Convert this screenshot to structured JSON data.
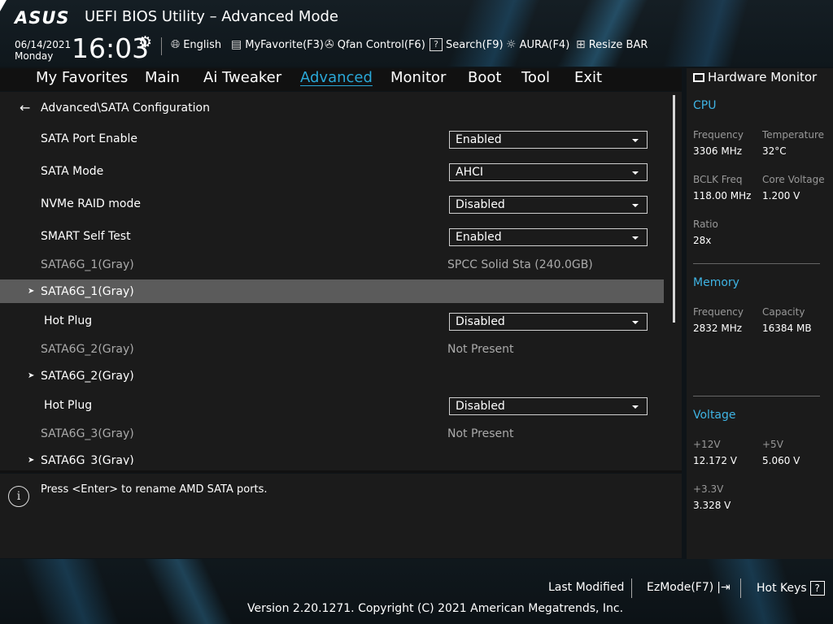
{
  "header": {
    "logo": "ASUS",
    "title": "UEFI BIOS Utility – Advanced Mode",
    "date": "06/14/2021",
    "day": "Monday",
    "time": "16:03"
  },
  "toolbar": [
    {
      "icon": "globe-icon",
      "label": "English"
    },
    {
      "icon": "favorite-list-icon",
      "label": "MyFavorite(F3)"
    },
    {
      "icon": "fan-icon",
      "label": "Qfan Control(F6)"
    },
    {
      "icon": "search-icon",
      "label": "Search(F9)"
    },
    {
      "icon": "aura-icon",
      "label": "AURA(F4)"
    },
    {
      "icon": "resize-bar-icon",
      "label": "Resize BAR"
    }
  ],
  "tabs": [
    "My Favorites",
    "Main",
    "Ai Tweaker",
    "Advanced",
    "Monitor",
    "Boot",
    "Tool",
    "Exit"
  ],
  "active_tab": "Advanced",
  "breadcrumb": "Advanced\\SATA Configuration",
  "settings": {
    "sata_port_enable": {
      "label": "SATA Port Enable",
      "value": "Enabled"
    },
    "sata_mode": {
      "label": "SATA Mode",
      "value": "AHCI"
    },
    "nvme_raid": {
      "label": "NVMe RAID mode",
      "value": "Disabled"
    },
    "smart_self_test": {
      "label": "SMART Self Test",
      "value": "Enabled"
    },
    "sata1_info": {
      "label": "SATA6G_1(Gray)",
      "value": "SPCC Solid Sta (240.0GB)"
    },
    "sata1_sub": {
      "label": "SATA6G_1(Gray)"
    },
    "sata1_hotplug": {
      "label": "Hot Plug",
      "value": "Disabled"
    },
    "sata2_info": {
      "label": "SATA6G_2(Gray)",
      "value": "Not Present"
    },
    "sata2_sub": {
      "label": "SATA6G_2(Gray)"
    },
    "sata2_hotplug": {
      "label": "Hot Plug",
      "value": "Disabled"
    },
    "sata3_info": {
      "label": "SATA6G_3(Gray)",
      "value": "Not Present"
    },
    "sata3_sub": {
      "label": "SATA6G_3(Gray)"
    }
  },
  "help_text": "Press <Enter> to rename AMD SATA ports.",
  "hardware_monitor": {
    "title": "Hardware Monitor",
    "cpu": {
      "title": "CPU",
      "frequency_label": "Frequency",
      "frequency": "3306 MHz",
      "temperature_label": "Temperature",
      "temperature": "32°C",
      "bclk_label": "BCLK Freq",
      "bclk": "118.00 MHz",
      "core_voltage_label": "Core Voltage",
      "core_voltage": "1.200 V",
      "ratio_label": "Ratio",
      "ratio": "28x"
    },
    "memory": {
      "title": "Memory",
      "frequency_label": "Frequency",
      "frequency": "2832 MHz",
      "capacity_label": "Capacity",
      "capacity": "16384 MB"
    },
    "voltage": {
      "title": "Voltage",
      "v12_label": "+12V",
      "v12": "12.172 V",
      "v5_label": "+5V",
      "v5": "5.060 V",
      "v33_label": "+3.3V",
      "v33": "3.328 V"
    }
  },
  "footer": {
    "last_modified": "Last Modified",
    "ezmode": "EzMode(F7)",
    "hot_keys": "Hot Keys",
    "hot_keys_symbol": "?",
    "version": "Version 2.20.1271. Copyright (C) 2021 American Megatrends, Inc."
  }
}
